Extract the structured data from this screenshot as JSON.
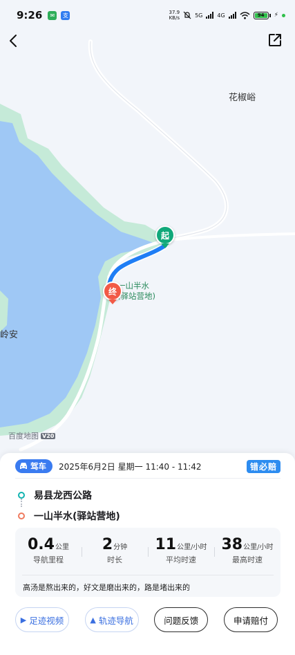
{
  "status": {
    "time": "9:26",
    "net_speed_value": "37.9",
    "net_speed_unit": "KB/s",
    "network_type_1": "5G",
    "network_type_2": "4G",
    "battery": "94"
  },
  "map": {
    "place_top_right": "花椒峪",
    "place_left": "岭安",
    "poi_name_line1": "一山半水",
    "poi_name_line2": "(驿站营地)",
    "start_marker": "起",
    "end_marker": "终",
    "watermark": "百度地图",
    "watermark_badge": "V20"
  },
  "trip": {
    "mode": "驾车",
    "datetime": "2025年6月2日 星期一 11:40 - 11:42",
    "claim_badge": "错必赔",
    "origin": "易县龙西公路",
    "destination": "一山半水(驿站营地)",
    "stats": [
      {
        "value": "0.4",
        "unit": "公里",
        "label": "导航里程"
      },
      {
        "value": "2",
        "unit": "分钟",
        "label": "时长"
      },
      {
        "value": "11",
        "unit": "公里/小时",
        "label": "平均时速"
      },
      {
        "value": "38",
        "unit": "公里/小时",
        "label": "最高时速"
      }
    ],
    "slogan": "高汤是熬出来的，好文是磨出来的，路是堵出来的"
  },
  "actions": {
    "track_video": "足迹视频",
    "track_navigation": "轨迹导航",
    "feedback": "问题反馈",
    "claim": "申请赔付"
  },
  "colors": {
    "route": "#1f7ef5",
    "water": "#9fc8f5",
    "shore": "#c5ead8",
    "start": "#11a87a",
    "end": "#f25a46"
  }
}
